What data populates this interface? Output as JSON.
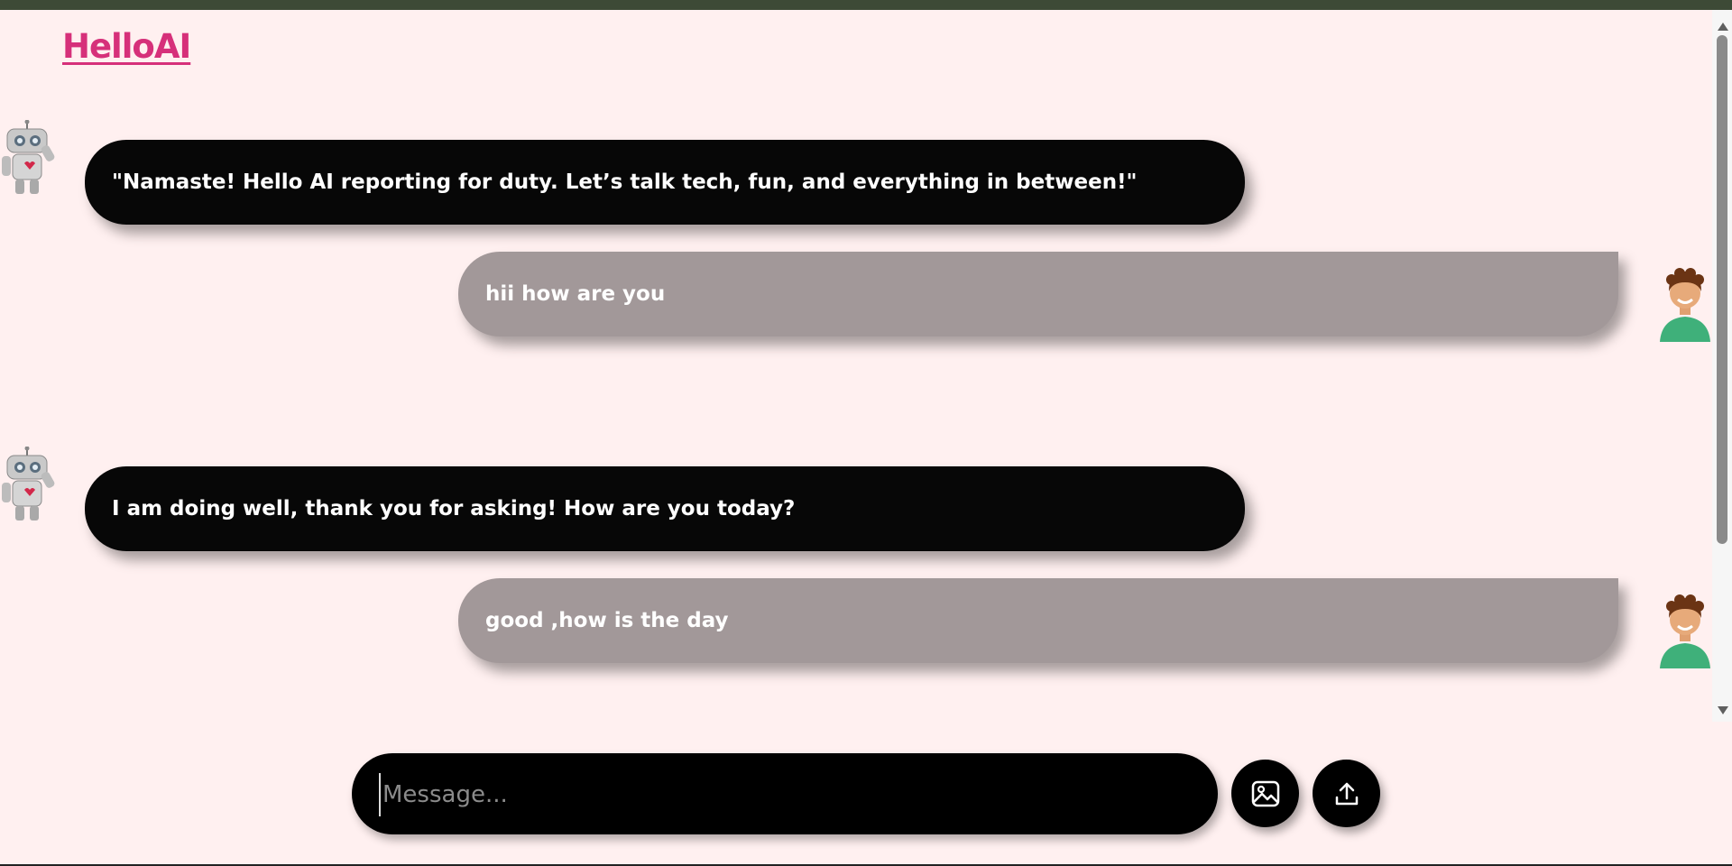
{
  "app": {
    "title": "HelloAI"
  },
  "messages": [
    {
      "role": "ai",
      "text": "\"Namaste! Hello AI reporting for duty. Let’s talk tech, fun, and everything in between!\"",
      "avatar": "robot-icon"
    },
    {
      "role": "user",
      "text": "hii how are you",
      "avatar": "user-avatar-icon"
    },
    {
      "role": "ai",
      "text": "I am doing well, thank you for asking! How are you today?",
      "avatar": "robot-icon"
    },
    {
      "role": "user",
      "text": "good ,how is the day",
      "avatar": "user-avatar-icon"
    }
  ],
  "composer": {
    "placeholder": "Message...",
    "value": ""
  },
  "actions": {
    "image_icon": "image-icon",
    "upload_icon": "upload-icon"
  },
  "colors": {
    "brand": "#d6307a",
    "ai_bubble": "#070707",
    "user_bubble": "#a29899",
    "background": "#fff0f0"
  }
}
